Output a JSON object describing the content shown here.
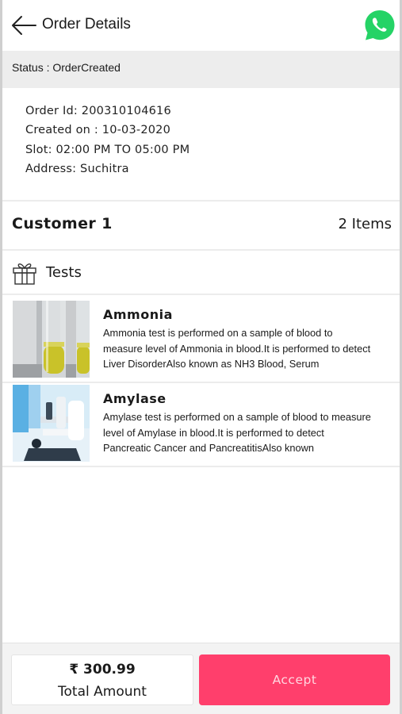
{
  "header": {
    "title": "Order Details",
    "back_icon": "arrow-left-icon",
    "whatsapp_icon": "whatsapp-icon"
  },
  "status": {
    "text": "Status : OrderCreated"
  },
  "order": {
    "id_label": "Order Id:",
    "id_value": "200310104616",
    "created_label": "Created on :",
    "created_value": "10-03-2020",
    "slot_label": "Slot:",
    "slot_value": "02:00 PM TO 05:00 PM",
    "address_label": "Address:",
    "address_value": "Suchitra"
  },
  "customer": {
    "name": "Customer 1",
    "items": "2 Items"
  },
  "tests": {
    "heading": "Tests",
    "icon": "gift-icon",
    "list": [
      {
        "name": "Ammonia",
        "description": "Ammonia test is performed on a sample of blood to measure level of Ammonia in blood.It is performed to detect Liver DisorderAlso known as NH3 Blood, Serum"
      },
      {
        "name": "Amylase",
        "description": "Amylase test is performed on a sample of blood to measure level of Amylase in blood.It is performed to detect Pancreatic Cancer and PancreatitisAlso known"
      }
    ]
  },
  "footer": {
    "total_value": "₹ 300.99",
    "total_label": "Total Amount",
    "accept_label": "Accept"
  },
  "colors": {
    "accent": "#ff3f6c",
    "whatsapp": "#25d366",
    "status_bg": "#ededed"
  }
}
